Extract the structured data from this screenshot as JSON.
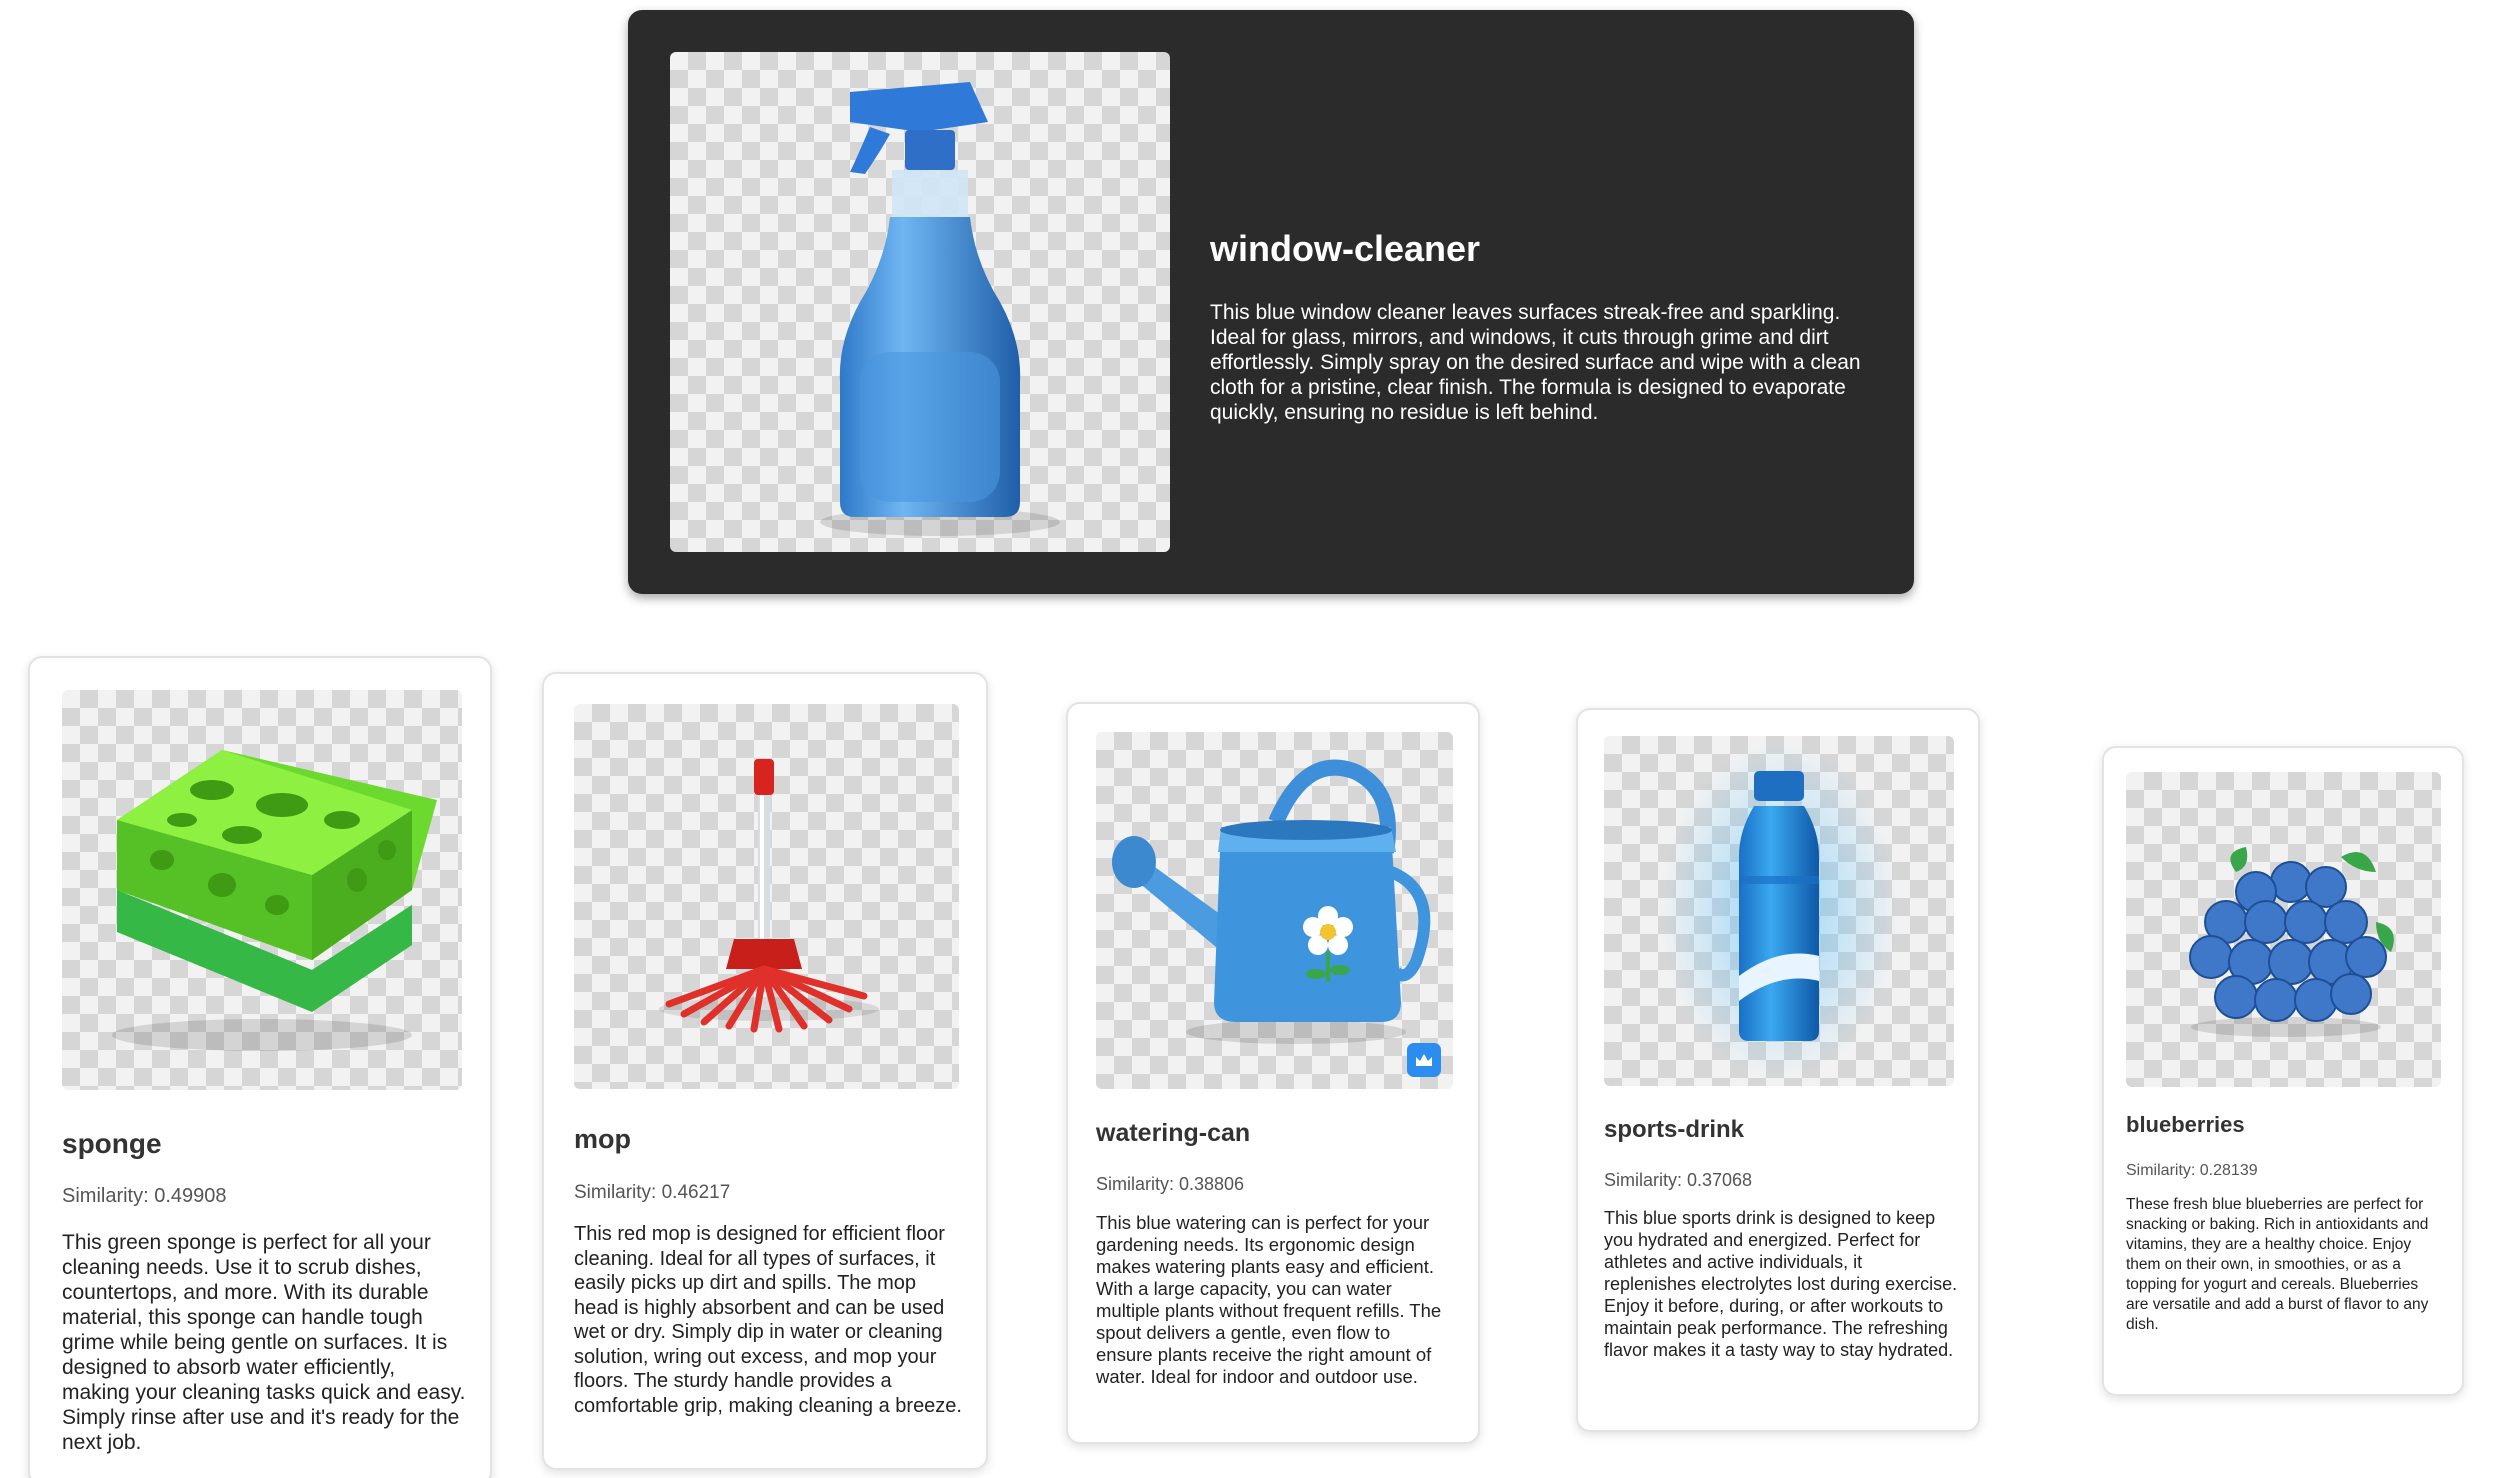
{
  "hero": {
    "title": "window-cleaner",
    "description": "This blue window cleaner leaves surfaces streak-free and sparkling. Ideal for glass, mirrors, and windows, it cuts through grime and dirt effortlessly. Simply spray on the desired surface and wipe with a clean cloth for a pristine, clear finish. The formula is designed to evaporate quickly, ensuring no residue is left behind.",
    "image_icon": "spray-bottle-icon"
  },
  "results": [
    {
      "name": "sponge",
      "similarity": "Similarity: 0.49908",
      "description": "This green sponge is perfect for all your cleaning needs. Use it to scrub dishes, countertops, and more. With its durable material, this sponge can handle tough grime while being gentle on surfaces. It is designed to absorb water efficiently, making your cleaning tasks quick and easy. Simply rinse after use and it's ready for the next job.",
      "image_icon": "sponge-icon"
    },
    {
      "name": "mop",
      "similarity": "Similarity: 0.46217",
      "description": "This red mop is designed for efficient floor cleaning. Ideal for all types of surfaces, it easily picks up dirt and spills. The mop head is highly absorbent and can be used wet or dry. Simply dip in water or cleaning solution, wring out excess, and mop your floors. The sturdy handle provides a comfortable grip, making cleaning a breeze.",
      "image_icon": "mop-icon"
    },
    {
      "name": "watering-can",
      "similarity": "Similarity: 0.38806",
      "description": "This blue watering can is perfect for your gardening needs. Its ergonomic design makes watering plants easy and efficient. With a large capacity, you can water multiple plants without frequent refills. The spout delivers a gentle, even flow to ensure plants receive the right amount of water. Ideal for indoor and outdoor use.",
      "image_icon": "watering-can-icon"
    },
    {
      "name": "sports-drink",
      "similarity": "Similarity: 0.37068",
      "description": "This blue sports drink is designed to keep you hydrated and energized. Perfect for athletes and active individuals, it replenishes electrolytes lost during exercise. Enjoy it before, during, or after workouts to maintain peak performance. The refreshing flavor makes it a tasty way to stay hydrated.",
      "image_icon": "water-bottle-icon"
    },
    {
      "name": "blueberries",
      "similarity": "Similarity: 0.28139",
      "description": "These fresh blue blueberries are perfect for snacking or baking. Rich in antioxidants and vitamins, they are a healthy choice. Enjoy them on their own, in smoothies, or as a topping for yogurt and cereals. Blueberries are versatile and add a burst of flavor to any dish.",
      "image_icon": "blueberries-icon"
    }
  ]
}
